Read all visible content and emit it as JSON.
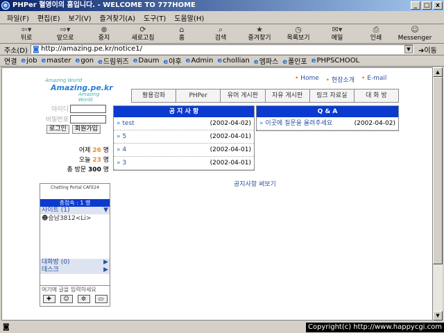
{
  "window": {
    "title": "PHPer 혈영이의 홈입니다. - WELCOME TO 777HOME",
    "status": "",
    "copyright": "Copyright(c) http://www.happycgi.com"
  },
  "menu": [
    "파일(F)",
    "편집(E)",
    "보기(V)",
    "즐겨찾기(A)",
    "도구(T)",
    "도움말(H)"
  ],
  "toolbar": [
    {
      "label": "뒤로",
      "icon": "back-icon"
    },
    {
      "label": "앞으로",
      "icon": "forward-icon"
    },
    {
      "label": "중지",
      "icon": "stop-icon"
    },
    {
      "label": "새로고침",
      "icon": "refresh-icon"
    },
    {
      "label": "홈",
      "icon": "home-icon"
    },
    {
      "label": "검색",
      "icon": "search-icon"
    },
    {
      "label": "즐겨찾기",
      "icon": "favorites-icon"
    },
    {
      "label": "목록보기",
      "icon": "history-icon"
    },
    {
      "label": "메일",
      "icon": "mail-icon"
    },
    {
      "label": "인쇄",
      "icon": "print-icon"
    },
    {
      "label": "Messenger",
      "icon": "messenger-icon"
    }
  ],
  "address": {
    "label": "주소(D)",
    "url": "http://amazing.pe.kr/notice1/",
    "go": "이동"
  },
  "links": {
    "label": "연결",
    "items": [
      "job",
      "master",
      "gon",
      "드림위즈",
      "Daum",
      "야후",
      "Admin",
      "chollian",
      "엠파스",
      "폴인포",
      "PHPSCHOOL"
    ]
  },
  "site": {
    "logo": {
      "top": "Amazing World",
      "main": "Amazing.pe.kr",
      "bottom": "Amazing World"
    },
    "toplinks": [
      "Home",
      "현장소개",
      "E-mail"
    ],
    "nav": [
      "활용강좌",
      "PHPer",
      "유머 게시판",
      "자유 게시판",
      "링크 자료실",
      "대 화 방"
    ],
    "login": {
      "id_label": "아이디",
      "pw_label": "비밀번호",
      "login_btn": "로그인",
      "join_btn": "회원가입"
    },
    "stats": {
      "yesterday_label": "어제",
      "yesterday": "26",
      "today_label": "오늘",
      "today": "23",
      "total_label": "총 방문",
      "total": "300",
      "unit": "명"
    },
    "notice": {
      "title": "공 지 사 항",
      "more": "공지사항 써보기",
      "items": [
        {
          "title": "test",
          "date": "(2002-04-02)"
        },
        {
          "title": "5",
          "date": "(2002-04-01)"
        },
        {
          "title": "4",
          "date": "(2002-04-01)"
        },
        {
          "title": "3",
          "date": "(2002-04-01)"
        }
      ]
    },
    "qna": {
      "title": "Q & A",
      "items": [
        {
          "title": "이곳에 질문을 올려주세요",
          "date": "(2002-04-02)"
        }
      ]
    },
    "chat": {
      "logo": "Chatting Portal CAFE24",
      "count": "총접속 : 1 명",
      "site": "사이트 (1)",
      "user": "승남3812<Li>",
      "room": "대화방 (0)",
      "desk": "데스크",
      "input": "여기에 글을 입력하세요"
    }
  }
}
